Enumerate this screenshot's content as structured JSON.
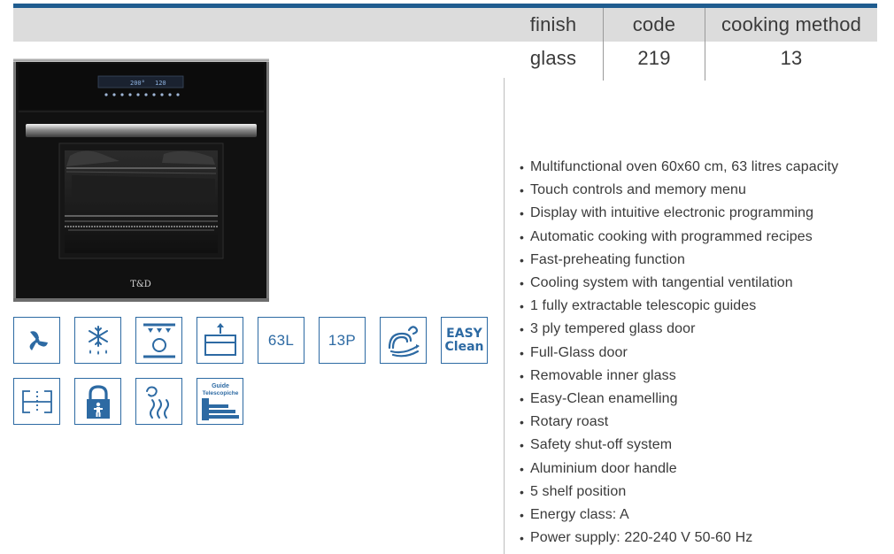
{
  "header_colors": {
    "rule": "#1f5c8f",
    "band": "#dcdcdc",
    "icon_blue": "#2d6aa3"
  },
  "spec_table": {
    "headers": [
      "finish",
      "code",
      "cooking method"
    ],
    "values": [
      "glass",
      "219",
      "13"
    ]
  },
  "oven": {
    "brand": "T&D",
    "display_temp": "200°",
    "display_time": "120"
  },
  "feature_icons": [
    {
      "name": "fan-icon",
      "label": ""
    },
    {
      "name": "defrost-icon",
      "label": ""
    },
    {
      "name": "grill-icon",
      "label": ""
    },
    {
      "name": "removable-inner-glass-icon",
      "label": ""
    },
    {
      "name": "capacity-badge",
      "label": "63L"
    },
    {
      "name": "programs-badge",
      "label": "13P"
    },
    {
      "name": "ventilation-icon",
      "label": ""
    },
    {
      "name": "easy-clean-badge",
      "label_top": "EASY",
      "label_bottom": "Clean"
    },
    {
      "name": "oven-size-icon",
      "label": ""
    },
    {
      "name": "child-lock-icon",
      "label": ""
    },
    {
      "name": "steam-clean-icon",
      "label": ""
    },
    {
      "name": "telescopic-guides-icon",
      "label_top": "Guide",
      "label_bottom": "Telescopiche"
    }
  ],
  "features": [
    "Multifunctional oven 60x60 cm, 63 litres capacity",
    "Touch controls and memory menu",
    "Display with intuitive electronic programming",
    "Automatic cooking with programmed recipes",
    "Fast-preheating function",
    "Cooling system with tangential ventilation",
    "1 fully extractable telescopic guides",
    "3 ply tempered glass door",
    "Full-Glass door",
    "Removable inner glass",
    "Easy-Clean enamelling",
    "Rotary roast",
    "Safety shut-off system",
    "Aluminium door handle",
    "5 shelf position",
    "Energy class: A",
    "Power supply: 220-240 V 50-60 Hz"
  ]
}
